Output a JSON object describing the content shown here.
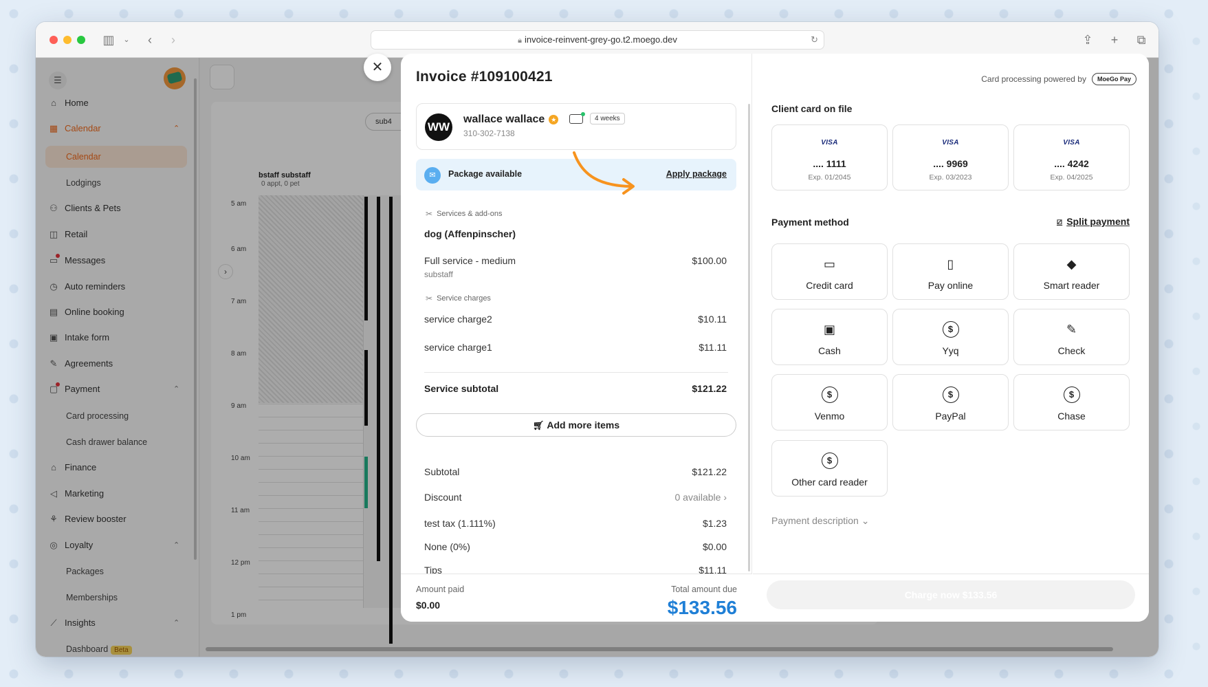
{
  "browser": {
    "url": "invoice-reinvent-grey-go.t2.moego.dev"
  },
  "sidebar": {
    "items": [
      {
        "label": "Home",
        "icon": "home-icon"
      },
      {
        "label": "Calendar",
        "icon": "calendar-icon"
      },
      {
        "label": "Clients & Pets",
        "icon": "users-icon"
      },
      {
        "label": "Retail",
        "icon": "bag-icon"
      },
      {
        "label": "Messages",
        "icon": "message-icon"
      },
      {
        "label": "Auto reminders",
        "icon": "clock-icon"
      },
      {
        "label": "Online booking",
        "icon": "booking-icon"
      },
      {
        "label": "Intake form",
        "icon": "form-icon"
      },
      {
        "label": "Agreements",
        "icon": "pen-icon"
      },
      {
        "label": "Payment",
        "icon": "wallet-icon"
      },
      {
        "label": "Finance",
        "icon": "bank-icon"
      },
      {
        "label": "Marketing",
        "icon": "megaphone-icon"
      },
      {
        "label": "Review booster",
        "icon": "review-icon"
      },
      {
        "label": "Loyalty",
        "icon": "loyalty-icon"
      },
      {
        "label": "Insights",
        "icon": "chart-icon"
      }
    ],
    "calendar_sub": [
      "Calendar",
      "Lodgings"
    ],
    "payment_sub": [
      "Card processing",
      "Cash drawer balance"
    ],
    "loyalty_sub": [
      "Packages",
      "Memberships"
    ],
    "insights_sub": [
      "Dashboard"
    ],
    "beta_badge": "Beta"
  },
  "calendar": {
    "pill": "sub4",
    "staff_name": "bstaff substaff",
    "staff_meta": "0 appt, 0 pet",
    "hours": [
      "5 am",
      "6 am",
      "7 am",
      "8 am",
      "9 am",
      "10 am",
      "11 am",
      "12 pm",
      "1 pm"
    ]
  },
  "invoice": {
    "title": "Invoice #109100421",
    "client": {
      "initials": "WW",
      "name": "wallace wallace",
      "phone": "310-302-7138",
      "frequency": "4 weeks"
    },
    "package": {
      "text": "Package available",
      "action": "Apply package"
    },
    "services_label": "Services & add-ons",
    "pet": "dog (Affenpinscher)",
    "service": {
      "name": "Full service - medium",
      "amount": "$100.00",
      "staff": "substaff"
    },
    "charges_label": "Service charges",
    "charges": [
      {
        "name": "service charge2",
        "amount": "$10.11"
      },
      {
        "name": "service charge1",
        "amount": "$11.11"
      }
    ],
    "service_subtotal": {
      "label": "Service subtotal",
      "amount": "$121.22"
    },
    "add_items": "Add more items",
    "summary": [
      {
        "label": "Subtotal",
        "amount": "$121.22"
      },
      {
        "label": "Discount",
        "amount": "0 available"
      },
      {
        "label": "test tax (1.111%)",
        "amount": "$1.23"
      },
      {
        "label": "None (0%)",
        "amount": "$0.00"
      },
      {
        "label": "Tips",
        "amount": "$11.11"
      }
    ],
    "amount_paid_label": "Amount paid",
    "amount_paid": "$0.00",
    "total_due_label": "Total amount due",
    "total_due": "$133.56"
  },
  "payment": {
    "powered_by": "Card processing powered by",
    "powered_brand": "MoeGo Pay",
    "cards_label": "Client card on file",
    "cards": [
      {
        "brand": "VISA",
        "number": ".... 1111",
        "exp": "Exp. 01/2045"
      },
      {
        "brand": "VISA",
        "number": ".... 9969",
        "exp": "Exp. 03/2023"
      },
      {
        "brand": "VISA",
        "number": ".... 4242",
        "exp": "Exp. 04/2025"
      }
    ],
    "method_label": "Payment method",
    "split": "Split payment",
    "methods": [
      {
        "label": "Credit card",
        "icon": "credit-card-icon"
      },
      {
        "label": "Pay online",
        "icon": "pay-online-icon"
      },
      {
        "label": "Smart reader",
        "icon": "smart-reader-icon"
      },
      {
        "label": "Cash",
        "icon": "cash-icon"
      },
      {
        "label": "Yyq",
        "icon": "dollar-circle-icon"
      },
      {
        "label": "Check",
        "icon": "check-icon"
      },
      {
        "label": "Venmo",
        "icon": "dollar-circle-icon"
      },
      {
        "label": "PayPal",
        "icon": "dollar-circle-icon"
      },
      {
        "label": "Chase",
        "icon": "dollar-circle-icon"
      },
      {
        "label": "Other card reader",
        "icon": "dollar-circle-icon"
      }
    ],
    "description": "Payment description",
    "charge_button": "Charge now $133.56"
  },
  "colors": {
    "accent": "#f26b1d",
    "total_blue": "#1f7fd6",
    "package_bg": "#e7f3fc"
  }
}
